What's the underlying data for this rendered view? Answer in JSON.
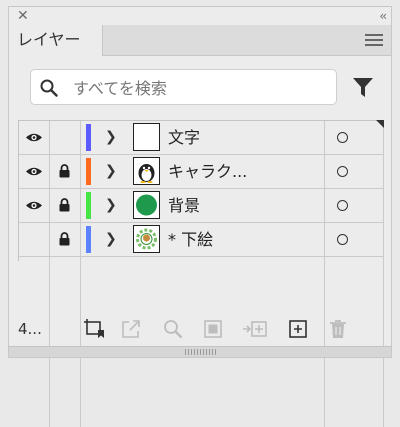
{
  "window": {
    "close_glyph": "✕",
    "collapse_glyph": "‹‹"
  },
  "tabs": [
    {
      "label": "レイヤー"
    }
  ],
  "panel_menu_icon": "hamburger-icon",
  "search": {
    "placeholder": "すべてを検索",
    "value": ""
  },
  "filter_icon": "filter-icon",
  "layers": [
    {
      "name": "文字",
      "visible": true,
      "locked": false,
      "color": "#5b5bff",
      "thumb": "blank"
    },
    {
      "name": "キャラク...",
      "visible": true,
      "locked": true,
      "color": "#ff6a1f",
      "thumb": "penguin"
    },
    {
      "name": "背景",
      "visible": true,
      "locked": true,
      "color": "#46e546",
      "thumb": "green-circle"
    },
    {
      "name": "* 下絵",
      "visible": false,
      "locked": true,
      "color": "#5b83ff",
      "thumb": "sketch"
    }
  ],
  "footer": {
    "layer_count": "4...",
    "icons": [
      "artboard-collect-icon",
      "export-icon",
      "locate-icon",
      "clipping-mask-icon",
      "add-to-layer-icon",
      "new-layer-icon",
      "delete-icon"
    ]
  }
}
